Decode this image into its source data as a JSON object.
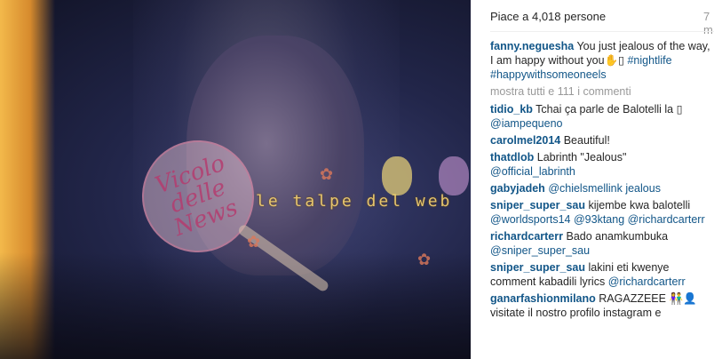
{
  "photo": {
    "watermark_text": "le talpe del web",
    "watermark_logo_text": "Vicolo delle News"
  },
  "sidebar": {
    "likes": "Piace a 4,018 persone",
    "time_ago": "7 m",
    "caption": {
      "user": "fanny.neguesha",
      "text": "You just jealous of the way, I am happy without you✋▯",
      "hashtags": "#nightlife #happywithsomeoneels"
    },
    "show_all_comments": "mostra tutti e 111 i commenti",
    "comments": [
      {
        "user": "tidio_kb",
        "text": "Tchai ça parle de Balotelli la ▯",
        "mention": "@iampequeno"
      },
      {
        "user": "carolmel2014",
        "text": "Beautiful!",
        "mention": ""
      },
      {
        "user": "thatdlob",
        "text": "Labrinth \"Jealous\"",
        "mention": "@official_labrinth"
      },
      {
        "user": "gabyjadeh",
        "text": "",
        "mention": "@chielsmellink jealous"
      },
      {
        "user": "sniper_super_sau",
        "text": "kijembe kwa balotelli",
        "mention": "@worldsports14 @93ktang @richardcarterr"
      },
      {
        "user": "richardcarterr",
        "text": "Bado anamkumbuka",
        "mention": "@sniper_super_sau"
      },
      {
        "user": "sniper_super_sau",
        "text": "lakini eti kwenye comment kabadili lyrics",
        "mention": "@richardcarterr"
      },
      {
        "user": "ganarfashionmilano",
        "text": "RAGAZZEEE 👫👤 visitate il nostro profilo instagram e",
        "mention": ""
      }
    ]
  }
}
